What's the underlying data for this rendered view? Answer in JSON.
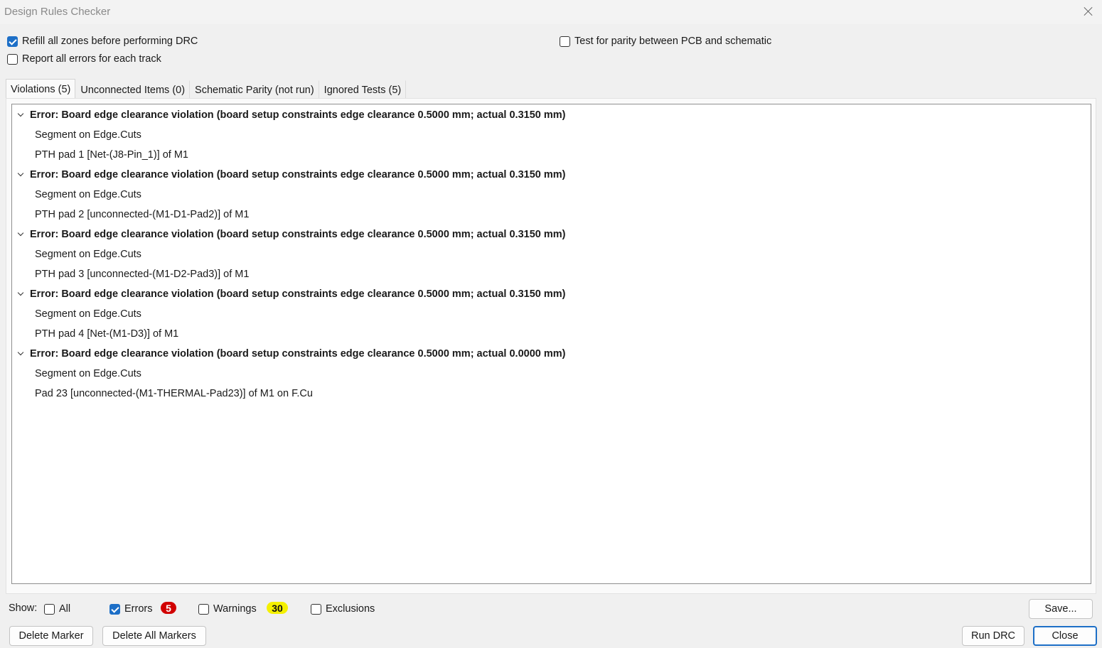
{
  "window": {
    "title": "Design Rules Checker"
  },
  "options": {
    "refill_zones": {
      "label": "Refill all zones before performing DRC",
      "checked": true
    },
    "report_all_errors": {
      "label": "Report all errors for each track",
      "checked": false
    },
    "test_parity": {
      "label": "Test for parity between PCB and schematic",
      "checked": false
    }
  },
  "tabs": [
    {
      "label": "Violations (5)",
      "active": true
    },
    {
      "label": "Unconnected Items (0)",
      "active": false
    },
    {
      "label": "Schematic Parity (not run)",
      "active": false
    },
    {
      "label": "Ignored Tests (5)",
      "active": false
    }
  ],
  "violations": [
    {
      "title": "Error: Board edge clearance violation (board setup constraints edge clearance 0.5000 mm; actual 0.3150 mm)",
      "items": [
        "Segment on Edge.Cuts",
        "PTH pad 1 [Net-(J8-Pin_1)] of M1"
      ]
    },
    {
      "title": "Error: Board edge clearance violation (board setup constraints edge clearance 0.5000 mm; actual 0.3150 mm)",
      "items": [
        "Segment on Edge.Cuts",
        "PTH pad 2 [unconnected-(M1-D1-Pad2)] of M1"
      ]
    },
    {
      "title": "Error: Board edge clearance violation (board setup constraints edge clearance 0.5000 mm; actual 0.3150 mm)",
      "items": [
        "Segment on Edge.Cuts",
        "PTH pad 3 [unconnected-(M1-D2-Pad3)] of M1"
      ]
    },
    {
      "title": "Error: Board edge clearance violation (board setup constraints edge clearance 0.5000 mm; actual 0.3150 mm)",
      "items": [
        "Segment on Edge.Cuts",
        "PTH pad 4 [Net-(M1-D3)] of M1"
      ]
    },
    {
      "title": "Error: Board edge clearance violation (board setup constraints edge clearance 0.5000 mm; actual 0.0000 mm)",
      "items": [
        "Segment on Edge.Cuts",
        "Pad 23 [unconnected-(M1-THERMAL-Pad23)] of M1 on F.Cu"
      ]
    }
  ],
  "filter": {
    "show_label": "Show:",
    "all": {
      "label": "All",
      "checked": false
    },
    "errors": {
      "label": "Errors",
      "checked": true,
      "count": "5",
      "badge_color": "#d10000"
    },
    "warnings": {
      "label": "Warnings",
      "checked": false,
      "count": "30",
      "badge_color": "#f4f000"
    },
    "exclusions": {
      "label": "Exclusions",
      "checked": false
    }
  },
  "buttons": {
    "save": "Save...",
    "delete_marker": "Delete Marker",
    "delete_all_markers": "Delete All Markers",
    "run_drc": "Run DRC",
    "close": "Close"
  },
  "colors": {
    "accent": "#1d6fc7",
    "error_badge": "#d10000",
    "warning_badge": "#f4f000"
  }
}
